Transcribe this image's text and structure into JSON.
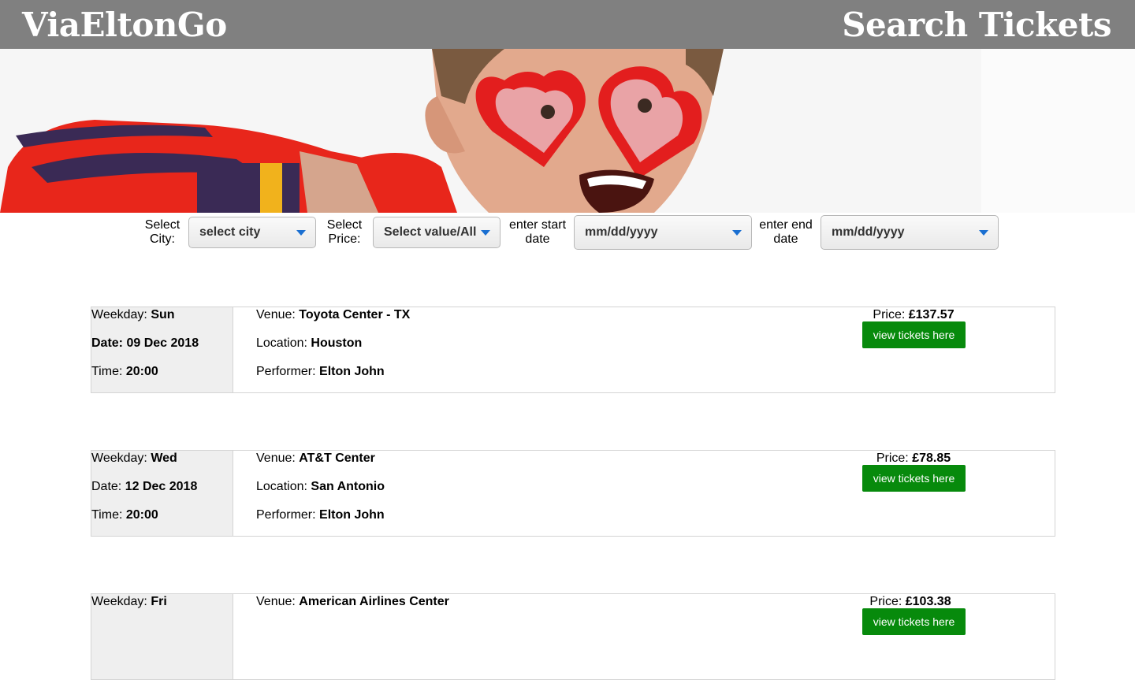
{
  "header": {
    "brand": "ViaEltonGo",
    "title": "Search Tickets"
  },
  "filters": {
    "city_label_1": "Select",
    "city_label_2": "City:",
    "city_value": "select city",
    "price_label_1": "Select",
    "price_label_2": "Price:",
    "price_value": "Select value/All",
    "start_label_1": "enter start",
    "start_label_2": "date",
    "start_value": "mm/dd/yyyy",
    "end_label_1": "enter end",
    "end_label_2": "date",
    "end_value": "mm/dd/yyyy"
  },
  "labels": {
    "weekday": "Weekday:",
    "date": "Date:",
    "time": "Time:",
    "venue": "Venue:",
    "location": "Location:",
    "performer": "Performer:",
    "price": "Price:",
    "button": "view tickets here"
  },
  "events": [
    {
      "weekday": "Sun",
      "date": "09 Dec 2018",
      "time": "20:00",
      "venue": "Toyota Center - TX",
      "location": "Houston",
      "performer": "Elton John",
      "price": "£137.57"
    },
    {
      "weekday": "Wed",
      "date": "12 Dec 2018",
      "time": "20:00",
      "venue": "AT&T Center",
      "location": "San Antonio",
      "performer": "Elton John",
      "price": "£78.85"
    },
    {
      "weekday": "Fri",
      "venue": "American Airlines Center",
      "price": "£103.38"
    }
  ],
  "colors": {
    "topbar": "#808080",
    "button": "#078a0c",
    "caret": "#1a6fd1"
  }
}
